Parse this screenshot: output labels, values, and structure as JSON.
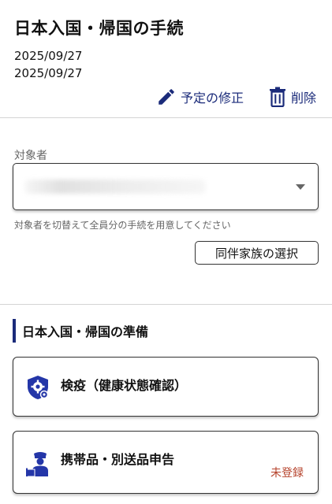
{
  "header": {
    "title": "日本入国・帰国の手続",
    "date_start": "2025/09/27",
    "date_end": "2025/09/27",
    "edit_label": "予定の修正",
    "delete_label": "削除",
    "edit_icon": "pencil-icon",
    "delete_icon": "trash-icon"
  },
  "target_person": {
    "label": "対象者",
    "selected_value": "",
    "hint": "対象者を切替えて全員分の手続を用意してください",
    "companion_button_label": "同伴家族の選択"
  },
  "preparation": {
    "section_title": "日本入国・帰国の準備",
    "cards": [
      {
        "title": "検疫（健康状態確認）",
        "icon": "shield-gear-icon",
        "status": ""
      },
      {
        "title": "携帯品・別送品申告",
        "icon": "customs-officer-icon",
        "status": "未登録"
      }
    ]
  },
  "colors": {
    "accent": "#1b2b7a",
    "status_unregistered": "#b5412a",
    "icon_blue": "#2436a8"
  }
}
